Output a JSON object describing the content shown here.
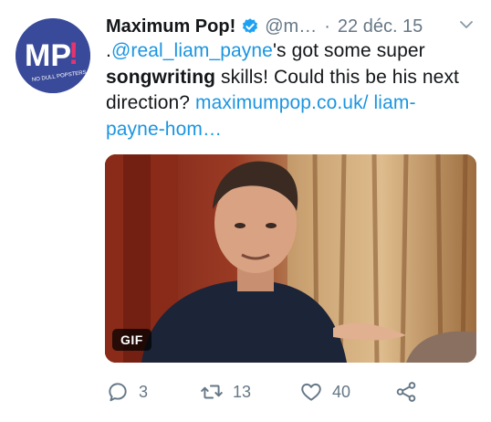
{
  "tweet": {
    "author_name": "Maximum Pop!",
    "handle": "@m…",
    "separator": "·",
    "date": "22 déc. 15",
    "avatar": {
      "text": "MP!",
      "tagline": "NO DULL POPSTERS"
    },
    "text_parts": {
      "p1": ".",
      "mention": "@real_liam_payne",
      "p2": "'s got some super ",
      "bold": "songwriting",
      "p3": " skills! Could this be his next direction? ",
      "link": "maximumpop.co.uk/ liam-payne-hom…"
    },
    "media_badge": "GIF"
  },
  "actions": {
    "replies": "3",
    "retweets": "13",
    "likes": "40"
  },
  "colors": {
    "link": "#1b95e0",
    "muted": "#657786",
    "verified": "#1da1f2"
  },
  "icons": [
    "verified-badge-icon",
    "chevron-down-icon",
    "reply-icon",
    "retweet-icon",
    "like-icon",
    "share-icon"
  ]
}
